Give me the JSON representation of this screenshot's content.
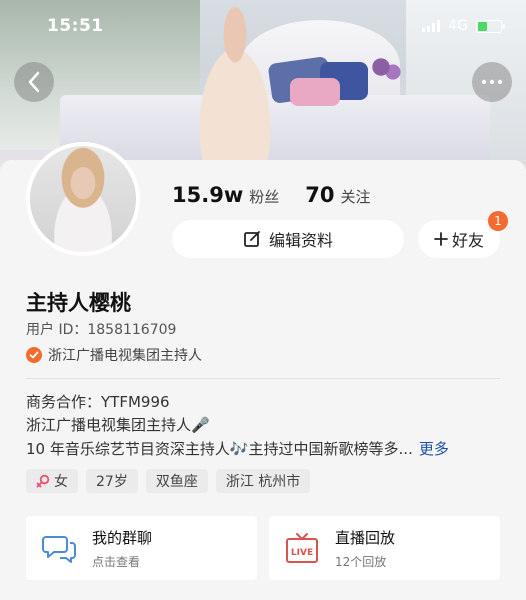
{
  "status_bar": {
    "time": "15:51",
    "network": "4G"
  },
  "profile": {
    "fans_count": "15.9w",
    "fans_label": "粉丝",
    "following_count": "70",
    "following_label": "关注",
    "edit_label": "编辑资料",
    "friend_label": "好友",
    "friend_badge": "1",
    "name": "主持人樱桃",
    "user_id": "用户 ID：1858116709",
    "verified_text": "浙江广播电视集团主持人",
    "bio": [
      "商务合作：YTFM996",
      "浙江广播电视集团主持人🎤",
      "10 年音乐综艺节目资深主持人🎶主持过中国新歌榜等多..."
    ],
    "more_label": "更多",
    "tags": [
      "女",
      "27岁",
      "双鱼座",
      "浙江 杭州市"
    ]
  },
  "cards": [
    {
      "title": "我的群聊",
      "subtitle": "点击查看",
      "icon": "chat-icon"
    },
    {
      "title": "直播回放",
      "subtitle": "12个回放",
      "icon": "live-icon",
      "icon_text": "LIVE"
    }
  ],
  "colors": {
    "accent": "#f46b2f",
    "link": "#1f4ea8",
    "chat_icon": "#4a8bd6",
    "live_icon": "#d9534f"
  }
}
